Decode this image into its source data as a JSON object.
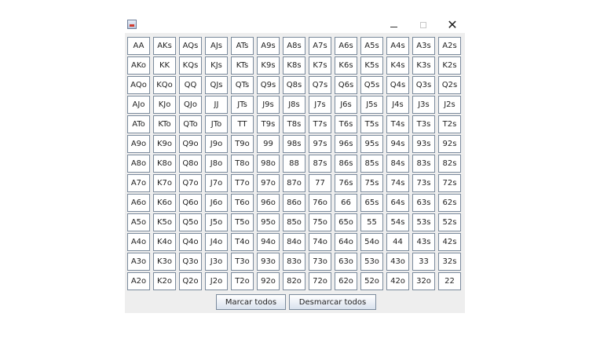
{
  "window": {
    "controls": {
      "minimize": "minimize-icon",
      "maximize": "maximize-icon",
      "close": "close-icon"
    }
  },
  "grid": {
    "rows": [
      [
        "AA",
        "AKs",
        "AQs",
        "AJs",
        "ATs",
        "A9s",
        "A8s",
        "A7s",
        "A6s",
        "A5s",
        "A4s",
        "A3s",
        "A2s"
      ],
      [
        "AKo",
        "KK",
        "KQs",
        "KJs",
        "KTs",
        "K9s",
        "K8s",
        "K7s",
        "K6s",
        "K5s",
        "K4s",
        "K3s",
        "K2s"
      ],
      [
        "AQo",
        "KQo",
        "QQ",
        "QJs",
        "QTs",
        "Q9s",
        "Q8s",
        "Q7s",
        "Q6s",
        "Q5s",
        "Q4s",
        "Q3s",
        "Q2s"
      ],
      [
        "AJo",
        "KJo",
        "QJo",
        "JJ",
        "JTs",
        "J9s",
        "J8s",
        "J7s",
        "J6s",
        "J5s",
        "J4s",
        "J3s",
        "J2s"
      ],
      [
        "ATo",
        "KTo",
        "QTo",
        "JTo",
        "TT",
        "T9s",
        "T8s",
        "T7s",
        "T6s",
        "T5s",
        "T4s",
        "T3s",
        "T2s"
      ],
      [
        "A9o",
        "K9o",
        "Q9o",
        "J9o",
        "T9o",
        "99",
        "98s",
        "97s",
        "96s",
        "95s",
        "94s",
        "93s",
        "92s"
      ],
      [
        "A8o",
        "K8o",
        "Q8o",
        "J8o",
        "T8o",
        "98o",
        "88",
        "87s",
        "86s",
        "85s",
        "84s",
        "83s",
        "82s"
      ],
      [
        "A7o",
        "K7o",
        "Q7o",
        "J7o",
        "T7o",
        "97o",
        "87o",
        "77",
        "76s",
        "75s",
        "74s",
        "73s",
        "72s"
      ],
      [
        "A6o",
        "K6o",
        "Q6o",
        "J6o",
        "T6o",
        "96o",
        "86o",
        "76o",
        "66",
        "65s",
        "64s",
        "63s",
        "62s"
      ],
      [
        "A5o",
        "K5o",
        "Q5o",
        "J5o",
        "T5o",
        "95o",
        "85o",
        "75o",
        "65o",
        "55",
        "54s",
        "53s",
        "52s"
      ],
      [
        "A4o",
        "K4o",
        "Q4o",
        "J4o",
        "T4o",
        "94o",
        "84o",
        "74o",
        "64o",
        "54o",
        "44",
        "43s",
        "42s"
      ],
      [
        "A3o",
        "K3o",
        "Q3o",
        "J3o",
        "T3o",
        "93o",
        "83o",
        "73o",
        "63o",
        "53o",
        "43o",
        "33",
        "32s"
      ],
      [
        "A2o",
        "K2o",
        "Q2o",
        "J2o",
        "T2o",
        "92o",
        "82o",
        "72o",
        "62o",
        "52o",
        "42o",
        "32o",
        "22"
      ]
    ]
  },
  "buttons": {
    "mark_all": "Marcar todos",
    "unmark_all": "Desmarcar todos"
  }
}
